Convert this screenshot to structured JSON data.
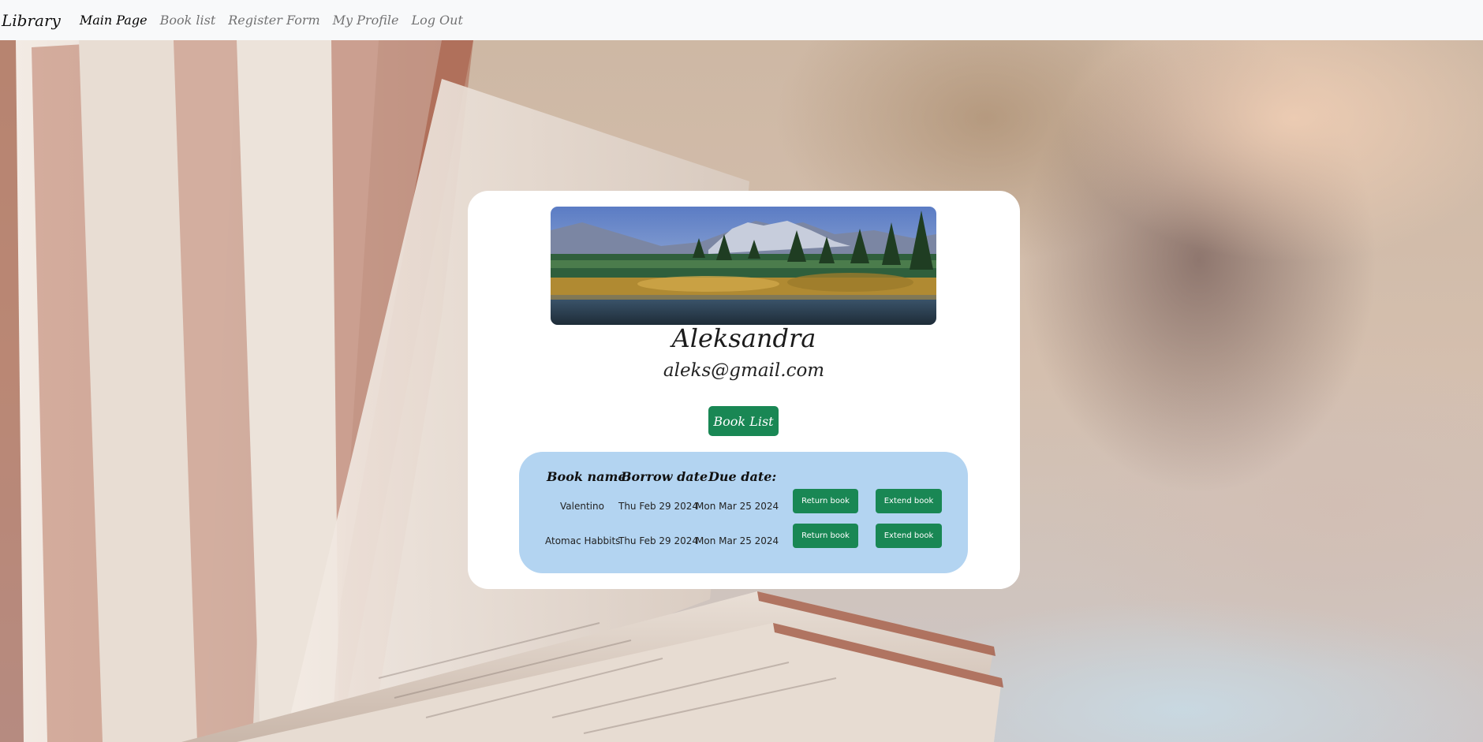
{
  "navbar": {
    "brand": "Library",
    "links": [
      {
        "label": "Main Page",
        "active": true
      },
      {
        "label": "Book list",
        "active": false
      },
      {
        "label": "Register Form",
        "active": false
      },
      {
        "label": "My Profile",
        "active": false
      },
      {
        "label": "Log Out",
        "active": false
      }
    ]
  },
  "profile": {
    "banner_image": "mountain-lake-landscape",
    "name": "Aleksandra",
    "email": "aleks@gmail.com",
    "book_list_button": "Book List"
  },
  "borrowed": {
    "headers": [
      "Book name:",
      "Borrow date",
      "Due date:"
    ],
    "rows": [
      {
        "book": "Valentino",
        "borrow_date": "Thu Feb 29 2024",
        "due_date": "Mon Mar 25 2024",
        "return_label": "Return book",
        "extend_label": "Extend book"
      },
      {
        "book": "Atomac Habbits",
        "borrow_date": "Thu Feb 29 2024",
        "due_date": "Mon Mar 25 2024",
        "return_label": "Return book",
        "extend_label": "Extend book"
      }
    ]
  },
  "colors": {
    "navbar_bg": "#f8f9fa",
    "button_green": "#198754",
    "table_bg": "#b3d4f1",
    "card_bg": "#ffffff"
  }
}
